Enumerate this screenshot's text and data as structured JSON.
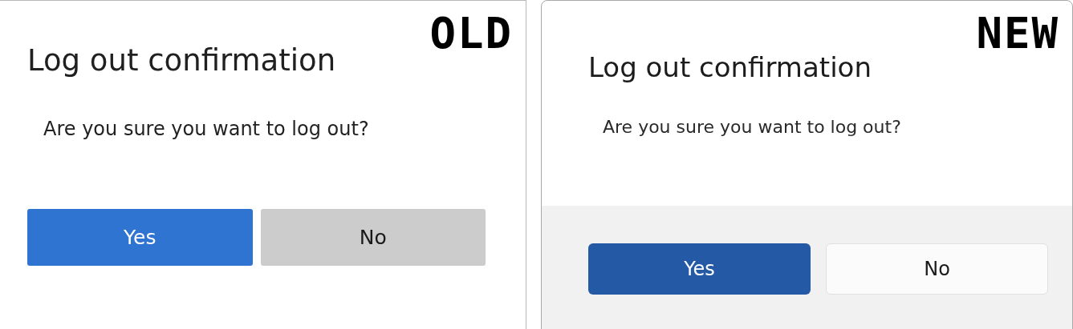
{
  "panels": [
    {
      "kind": "old",
      "tag": "OLD",
      "title": "Log out confirmation",
      "message": "Are you sure you want to log out?",
      "buttons": [
        {
          "label": "Yes",
          "primary": true
        },
        {
          "label": "No",
          "primary": false
        }
      ]
    },
    {
      "kind": "new",
      "tag": "NEW",
      "title": "Log out confirmation",
      "message": "Are you sure you want to log out?",
      "buttons": [
        {
          "label": "Yes",
          "primary": true
        },
        {
          "label": "No",
          "primary": false
        }
      ]
    }
  ]
}
